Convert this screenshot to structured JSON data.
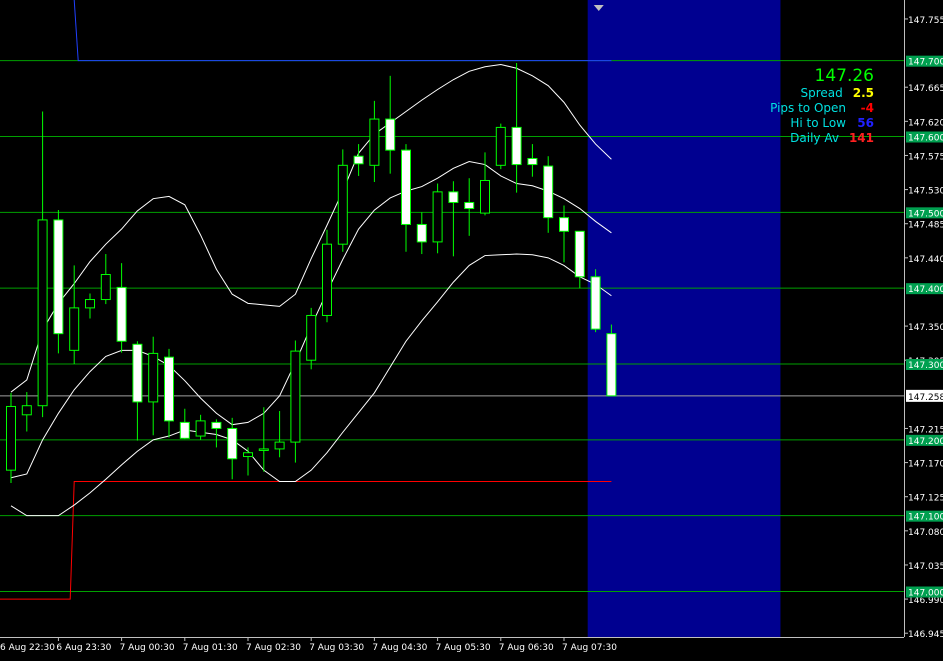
{
  "chart_data": {
    "type": "candlestick",
    "colors": {
      "background": "#000000",
      "up_body": "#000000",
      "down_body": "#ffffff",
      "wick": "#00ff00",
      "bands": "#ffffff",
      "blue_line": "#2040ff",
      "red_line": "#ff0000",
      "level_line": "#00a000",
      "level_label_bg": "#00a050",
      "future_zone": "#000090",
      "price_label_bg": "#ffffff",
      "axis": "#c0c0c0"
    },
    "y_axis": {
      "min": 146.94,
      "max": 147.78,
      "ticks": [
        "147.755",
        "147.665",
        "147.620",
        "147.575",
        "147.530",
        "147.485",
        "147.440",
        "147.350",
        "147.305",
        "147.215",
        "147.170",
        "147.125",
        "147.080",
        "147.035",
        "146.990",
        "146.945"
      ],
      "level_labels": [
        "147.700",
        "147.600",
        "147.500",
        "147.400",
        "147.300",
        "147.200",
        "147.100",
        "147.000"
      ],
      "current_price_label": "147.258",
      "current_price": 147.258
    },
    "x_axis": {
      "labels": [
        "6 Aug 22:30",
        "6 Aug 23:30",
        "7 Aug 00:30",
        "7 Aug 01:30",
        "7 Aug 02:30",
        "7 Aug 03:30",
        "7 Aug 04:30",
        "7 Aug 05:30",
        "7 Aug 06:30",
        "7 Aug 07:30"
      ],
      "label_bar_index": [
        -1,
        3,
        7,
        11,
        15,
        19,
        23,
        27,
        31,
        35
      ]
    },
    "candles": [
      {
        "o": 147.16,
        "h": 147.262,
        "l": 147.143,
        "c": 147.244
      },
      {
        "o": 147.233,
        "h": 147.263,
        "l": 147.211,
        "c": 147.245
      },
      {
        "o": 147.245,
        "h": 147.633,
        "l": 147.23,
        "c": 147.49
      },
      {
        "o": 147.49,
        "h": 147.503,
        "l": 147.314,
        "c": 147.34
      },
      {
        "o": 147.318,
        "h": 147.43,
        "l": 147.3,
        "c": 147.374
      },
      {
        "o": 147.374,
        "h": 147.393,
        "l": 147.36,
        "c": 147.385
      },
      {
        "o": 147.385,
        "h": 147.445,
        "l": 147.379,
        "c": 147.418
      },
      {
        "o": 147.401,
        "h": 147.433,
        "l": 147.315,
        "c": 147.33
      },
      {
        "o": 147.326,
        "h": 147.33,
        "l": 147.199,
        "c": 147.25
      },
      {
        "o": 147.25,
        "h": 147.336,
        "l": 147.206,
        "c": 147.314
      },
      {
        "o": 147.309,
        "h": 147.32,
        "l": 147.203,
        "c": 147.225
      },
      {
        "o": 147.223,
        "h": 147.241,
        "l": 147.201,
        "c": 147.202
      },
      {
        "o": 147.205,
        "h": 147.233,
        "l": 147.2,
        "c": 147.225
      },
      {
        "o": 147.223,
        "h": 147.227,
        "l": 147.19,
        "c": 147.215
      },
      {
        "o": 147.215,
        "h": 147.229,
        "l": 147.148,
        "c": 147.175
      },
      {
        "o": 147.178,
        "h": 147.19,
        "l": 147.153,
        "c": 147.183
      },
      {
        "o": 147.186,
        "h": 147.243,
        "l": 147.158,
        "c": 147.188
      },
      {
        "o": 147.188,
        "h": 147.238,
        "l": 147.177,
        "c": 147.197
      },
      {
        "o": 147.197,
        "h": 147.331,
        "l": 147.17,
        "c": 147.317
      },
      {
        "o": 147.305,
        "h": 147.374,
        "l": 147.293,
        "c": 147.364
      },
      {
        "o": 147.364,
        "h": 147.477,
        "l": 147.355,
        "c": 147.458
      },
      {
        "o": 147.458,
        "h": 147.583,
        "l": 147.448,
        "c": 147.562
      },
      {
        "o": 147.574,
        "h": 147.59,
        "l": 147.548,
        "c": 147.564
      },
      {
        "o": 147.562,
        "h": 147.647,
        "l": 147.54,
        "c": 147.623
      },
      {
        "o": 147.623,
        "h": 147.68,
        "l": 147.551,
        "c": 147.582
      },
      {
        "o": 147.582,
        "h": 147.59,
        "l": 147.448,
        "c": 147.484
      },
      {
        "o": 147.484,
        "h": 147.5,
        "l": 147.445,
        "c": 147.461
      },
      {
        "o": 147.461,
        "h": 147.538,
        "l": 147.446,
        "c": 147.527
      },
      {
        "o": 147.527,
        "h": 147.541,
        "l": 147.442,
        "c": 147.513
      },
      {
        "o": 147.513,
        "h": 147.545,
        "l": 147.469,
        "c": 147.505
      },
      {
        "o": 147.499,
        "h": 147.579,
        "l": 147.496,
        "c": 147.542
      },
      {
        "o": 147.562,
        "h": 147.617,
        "l": 147.557,
        "c": 147.612
      },
      {
        "o": 147.612,
        "h": 147.697,
        "l": 147.526,
        "c": 147.563
      },
      {
        "o": 147.571,
        "h": 147.59,
        "l": 147.547,
        "c": 147.563
      },
      {
        "o": 147.561,
        "h": 147.574,
        "l": 147.473,
        "c": 147.493
      },
      {
        "o": 147.493,
        "h": 147.509,
        "l": 147.434,
        "c": 147.475
      },
      {
        "o": 147.475,
        "h": 147.475,
        "l": 147.4,
        "c": 147.415
      },
      {
        "o": 147.415,
        "h": 147.425,
        "l": 147.342,
        "c": 147.346
      },
      {
        "o": 147.34,
        "h": 147.352,
        "l": 147.258,
        "c": 147.258
      }
    ],
    "bands_upper": [
      147.263,
      147.279,
      147.345,
      147.38,
      147.406,
      147.435,
      147.458,
      147.478,
      147.502,
      147.518,
      147.521,
      147.51,
      147.47,
      147.425,
      147.392,
      147.38,
      147.378,
      147.376,
      147.392,
      147.439,
      147.483,
      147.528,
      147.578,
      147.603,
      147.618,
      147.633,
      147.648,
      147.662,
      147.675,
      147.686,
      147.692,
      147.695,
      147.69,
      147.68,
      147.667,
      147.645,
      147.615,
      147.59,
      147.57
    ],
    "bands_middle": [
      147.15,
      147.155,
      147.2,
      147.235,
      147.266,
      147.29,
      147.31,
      147.318,
      147.318,
      147.31,
      147.298,
      147.278,
      147.255,
      147.235,
      147.22,
      147.223,
      147.235,
      147.258,
      147.302,
      147.35,
      147.395,
      147.438,
      147.478,
      147.503,
      147.519,
      147.528,
      147.534,
      147.545,
      147.558,
      147.567,
      147.563,
      147.548,
      147.538,
      147.535,
      147.528,
      147.518,
      147.505,
      147.488,
      147.473
    ],
    "bands_lower": [
      147.113,
      147.1,
      147.1,
      147.1,
      147.114,
      147.13,
      147.148,
      147.167,
      147.185,
      147.2,
      147.205,
      147.213,
      147.21,
      147.207,
      147.2,
      147.185,
      147.16,
      147.145,
      147.145,
      147.16,
      147.183,
      147.21,
      147.236,
      147.262,
      147.296,
      147.33,
      147.357,
      147.382,
      147.408,
      147.43,
      147.443,
      147.444,
      147.445,
      147.444,
      147.44,
      147.43,
      147.415,
      147.405,
      147.39
    ],
    "blue_line": {
      "start_price": 147.775,
      "level": 147.7,
      "from_bar": 4,
      "to_bar": 38
    },
    "red_line": {
      "level": 146.99,
      "to_level": 147.145,
      "from_bar": 0,
      "step_bar": 4,
      "to_bar": 38
    },
    "horizontal_levels": [
      147.7,
      147.6,
      147.5,
      147.4,
      147.3,
      147.2,
      147.1,
      147.0
    ],
    "current_price_line": 147.258
  },
  "info": {
    "price": "147.26",
    "rows": [
      {
        "label": "Spread",
        "value": "2.5",
        "label_color": "#00e0e0",
        "value_color": "#ffff00"
      },
      {
        "label": "Pips to Open",
        "value": "-4",
        "label_color": "#00e0e0",
        "value_color": "#ff0000"
      },
      {
        "label": "Hi to Low",
        "value": "56",
        "label_color": "#00e0e0",
        "value_color": "#2020ff"
      },
      {
        "label": "Daily Av",
        "value": "141",
        "label_color": "#00e0e0",
        "value_color": "#ff2020"
      }
    ]
  }
}
